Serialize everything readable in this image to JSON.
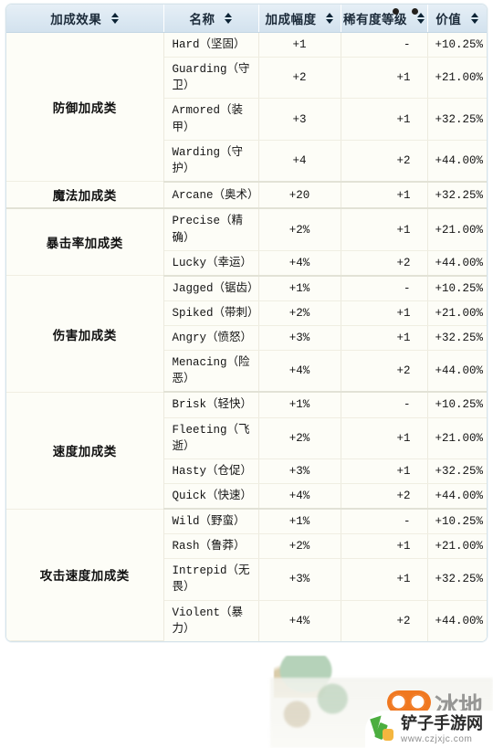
{
  "table": {
    "columns": [
      {
        "label": "加成效果",
        "sort_icon": "sort-updown-icon"
      },
      {
        "label": "名称",
        "sort_icon": "sort-updown-icon"
      },
      {
        "label": "加成幅度",
        "sort_icon": "sort-updown-icon"
      },
      {
        "label": "稀有度等级",
        "sort_icon": "sort-updown-icon"
      },
      {
        "label": "价值",
        "sort_icon": "sort-updown-icon"
      }
    ],
    "groups": [
      {
        "category": "防御加成类",
        "rows": [
          {
            "name": "Hard（坚固）",
            "amount": "+1",
            "rarity": "-",
            "value": "+10.25%"
          },
          {
            "name": "Guarding（守卫）",
            "amount": "+2",
            "rarity": "+1",
            "value": "+21.00%"
          },
          {
            "name": "Armored（装甲）",
            "amount": "+3",
            "rarity": "+1",
            "value": "+32.25%"
          },
          {
            "name": "Warding（守护）",
            "amount": "+4",
            "rarity": "+2",
            "value": "+44.00%"
          }
        ]
      },
      {
        "category": "魔法加成类",
        "rows": [
          {
            "name": "Arcane（奥术）",
            "amount": "+20",
            "rarity": "+1",
            "value": "+32.25%"
          }
        ]
      },
      {
        "category": "暴击率加成类",
        "rows": [
          {
            "name": "Precise（精确）",
            "amount": "+2%",
            "rarity": "+1",
            "value": "+21.00%"
          },
          {
            "name": "Lucky（幸运）",
            "amount": "+4%",
            "rarity": "+2",
            "value": "+44.00%"
          }
        ]
      },
      {
        "category": "伤害加成类",
        "rows": [
          {
            "name": "Jagged（锯齿）",
            "amount": "+1%",
            "rarity": "-",
            "value": "+10.25%"
          },
          {
            "name": "Spiked（带刺）",
            "amount": "+2%",
            "rarity": "+1",
            "value": "+21.00%"
          },
          {
            "name": "Angry（愤怒）",
            "amount": "+3%",
            "rarity": "+1",
            "value": "+32.25%"
          },
          {
            "name": "Menacing（险恶）",
            "amount": "+4%",
            "rarity": "+2",
            "value": "+44.00%"
          }
        ]
      },
      {
        "category": "速度加成类",
        "rows": [
          {
            "name": "Brisk（轻快）",
            "amount": "+1%",
            "rarity": "-",
            "value": "+10.25%"
          },
          {
            "name": "Fleeting（飞逝）",
            "amount": "+2%",
            "rarity": "+1",
            "value": "+21.00%"
          },
          {
            "name": "Hasty（仓促）",
            "amount": "+3%",
            "rarity": "+1",
            "value": "+32.25%"
          },
          {
            "name": "Quick（快速）",
            "amount": "+4%",
            "rarity": "+2",
            "value": "+44.00%"
          }
        ]
      },
      {
        "category": "攻击速度加成类",
        "rows": [
          {
            "name": "Wild（野蛮）",
            "amount": "+1%",
            "rarity": "-",
            "value": "+10.25%"
          },
          {
            "name": "Rash（鲁莽）",
            "amount": "+2%",
            "rarity": "+1",
            "value": "+21.00%"
          },
          {
            "name": "Intrepid（无畏）",
            "amount": "+3%",
            "rarity": "+1",
            "value": "+32.25%"
          },
          {
            "name": "Violent（暴力）",
            "amount": "+4%",
            "rarity": "+2",
            "value": "+44.00%"
          }
        ]
      }
    ]
  },
  "watermark": {
    "brand": "铲子手游网",
    "url": "www.czjxjc.com",
    "grey_text": "冰地",
    "logo_icon": "cursor-arrow-icon",
    "mascot_icon": "owl-eyes-icon"
  },
  "colors": {
    "header_bg": "#dbe8f2",
    "body_bg": "#fdfdf7",
    "border": "#d6e3ea",
    "text": "#171717",
    "accent_orange": "#f07820",
    "accent_green": "#4cae3f"
  }
}
